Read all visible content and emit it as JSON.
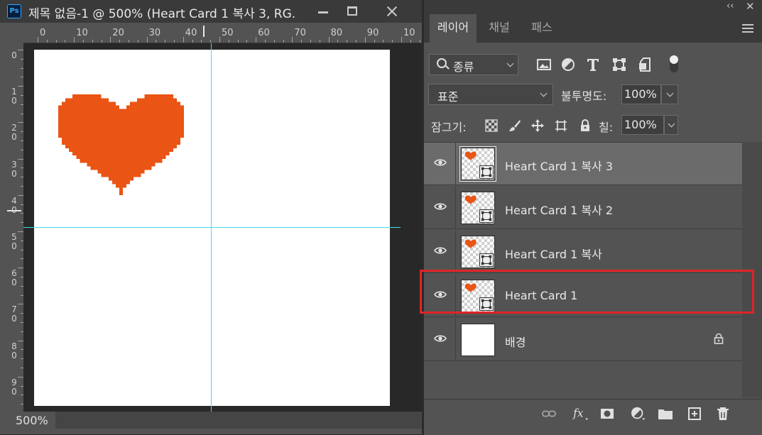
{
  "document": {
    "app_icon_text": "Ps",
    "title": "제목 없음-1 @ 500% (Heart Card 1 복사 3, RG...",
    "zoom": "500%",
    "ruler_top_labels": [
      "0",
      "10",
      "20",
      "30",
      "40",
      "50",
      "60",
      "70",
      "80",
      "90",
      "10"
    ],
    "ruler_left_labels": [
      "0",
      "1\n0",
      "2\n0",
      "3\n0",
      "4\n0",
      "5\n0",
      "6\n0",
      "7\n0",
      "8\n0",
      "9\n0"
    ],
    "heart_color": "#ea5414",
    "guide_color": "#44ddee"
  },
  "panel": {
    "tabs": [
      "레이어",
      "채널",
      "패스"
    ],
    "active_tab": "레이어",
    "filter": {
      "label": "종류"
    },
    "blend_mode": "표준",
    "opacity": {
      "label": "불투명도:",
      "value": "100%"
    },
    "lock": {
      "label": "잠그기:"
    },
    "fill": {
      "label": "칠:",
      "value": "100%"
    },
    "layers": [
      {
        "name": "Heart Card 1 복사 3",
        "selected": true
      },
      {
        "name": "Heart Card 1 복사 2",
        "selected": false
      },
      {
        "name": "Heart Card 1 복사",
        "selected": false
      },
      {
        "name": "Heart Card 1",
        "selected": false,
        "highlighted": true
      },
      {
        "name": "배경",
        "selected": false,
        "locked": true
      }
    ],
    "bottom_icons": [
      "link-icon",
      "fx-icon",
      "mask-icon",
      "adjustment-icon",
      "folder-icon",
      "new-layer-icon",
      "trash-icon"
    ],
    "highlight_color": "#e02424"
  }
}
